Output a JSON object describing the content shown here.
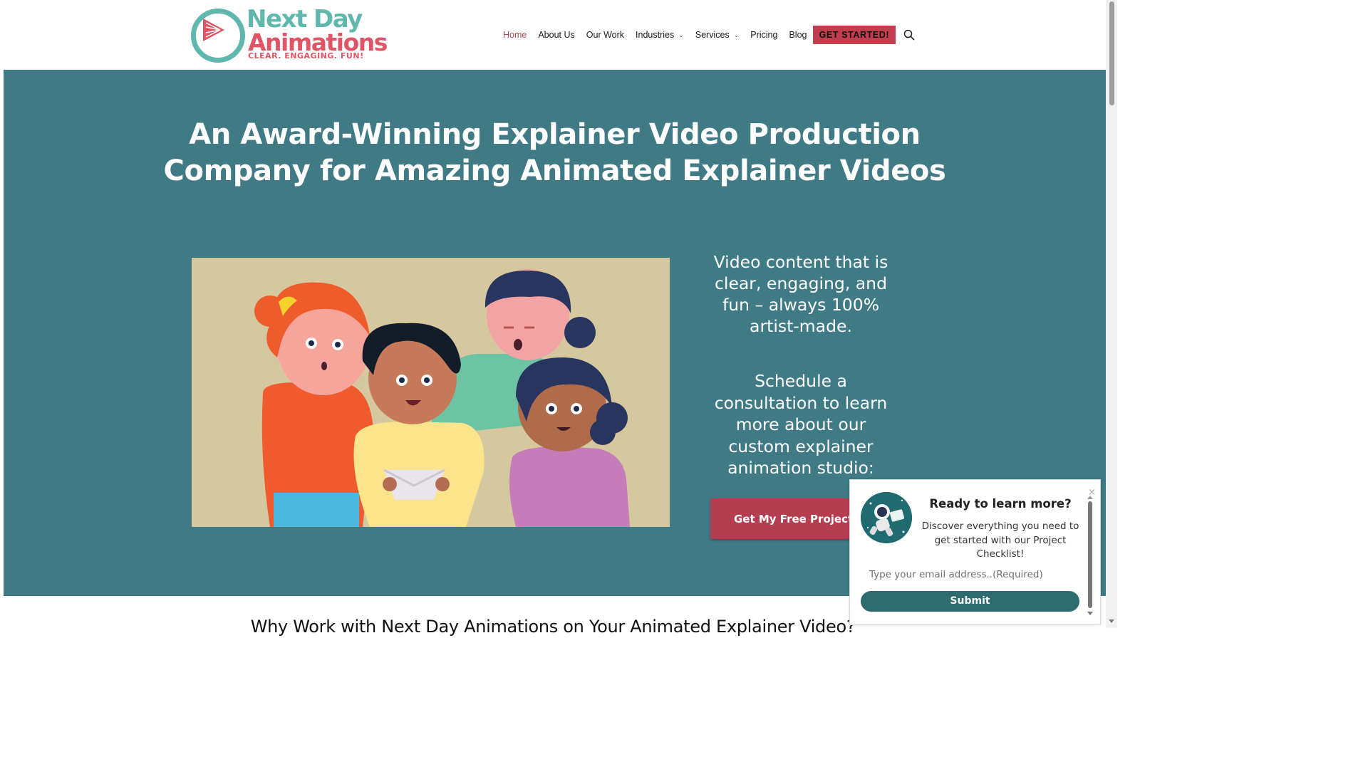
{
  "brand": {
    "name_line1": "Next Day",
    "name_line2": "Animations",
    "tagline": "CLEAR. ENGAGING. FUN!",
    "teal": "#5fb7ad",
    "red": "#e05565"
  },
  "nav": {
    "items": [
      {
        "label": "Home",
        "active": true
      },
      {
        "label": "About Us"
      },
      {
        "label": "Our Work"
      },
      {
        "label": "Industries",
        "dropdown": true
      },
      {
        "label": "Services",
        "dropdown": true
      },
      {
        "label": "Pricing"
      },
      {
        "label": "Blog"
      }
    ],
    "cta_label": "GET STARTED!",
    "search_icon": "search-icon"
  },
  "hero": {
    "title_line1": "An Award-Winning Explainer Video Production",
    "title_line2": "Company for Amazing Animated Explainer Videos",
    "tagline": "Video content that is clear, engaging, and fun – always 100% artist-made.",
    "schedule": "Schedule a consultation to learn more about our custom explainer animation studio:",
    "quote_button": "Get My Free Project Quote",
    "background": "#3f7a85"
  },
  "below": {
    "title": "Why Work with Next Day Animations on Your Animated Explainer Video?"
  },
  "popup": {
    "title": "Ready to learn more?",
    "text": "Discover everything you need to get started with our Project Checklist!",
    "email_placeholder": "Type your email address..(Required)",
    "submit_label": "Submit",
    "close_label": "×"
  }
}
